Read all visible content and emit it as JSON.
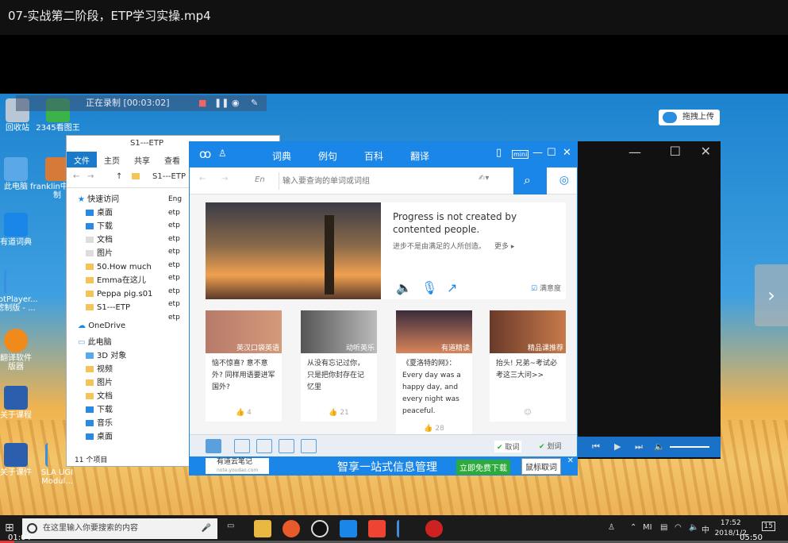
{
  "player": {
    "title": "07-实战第二阶段，ETP学习实操.mp4",
    "time_current": "01:04",
    "time_total": "05:50",
    "progress_fraction": 0.018
  },
  "recorder": {
    "status": "正在录制 [00:03:02]"
  },
  "upload": {
    "label": "拖拽上传"
  },
  "desktop_icons": [
    {
      "label": "回收站"
    },
    {
      "label": "2345看图王"
    },
    {
      "label": "此电脑"
    },
    {
      "label": "franklin中文录制"
    },
    {
      "label": "有道词典"
    },
    {
      "label": "PotPlayer...\n滤制版 - ..."
    },
    {
      "label": "翻译软件\n版器"
    },
    {
      "label": "关于课程"
    },
    {
      "label": "SLA UGI\nModul..."
    },
    {
      "label": "关于课件"
    }
  ],
  "explorer": {
    "path": "S1---ETP",
    "tabs": [
      "文件",
      "主页",
      "共享",
      "查看"
    ],
    "address": "S1---ETP",
    "nav": [
      "快速访问",
      "桌面",
      "下载",
      "文档",
      "图片",
      "50.How much",
      "Emma在这儿",
      "Peppa pig.s01",
      "S1---ETP",
      "OneDrive",
      "此电脑",
      "3D 对象",
      "视频",
      "图片",
      "文档",
      "下载",
      "音乐",
      "桌面"
    ],
    "files": [
      "Eng",
      "etp",
      "etp",
      "etp",
      "etp",
      "etp",
      "etp",
      "etp",
      "etp",
      "etp"
    ],
    "status": "11 个项目"
  },
  "dict": {
    "tabs": [
      "词典",
      "例句",
      "百科",
      "翻译"
    ],
    "mini_label": "mini",
    "lang": "En",
    "search_placeholder": "输入要查询的单词或词组",
    "quote_en": "Progress is not created by contented people.",
    "quote_cn": "进步不是由满足的人所创造。",
    "more": "更多 ▸",
    "satisfaction": "满意度",
    "cards": [
      {
        "tag": "英汉口袋英语",
        "text": "恼不惊喜? 意不意外? 同样用语要进军国外?",
        "likes": "4"
      },
      {
        "tag": "动听英乐",
        "text": "从没有忘记过你，只是把你封存在记忆里",
        "likes": "21"
      },
      {
        "tag": "有道精读",
        "text": "《夏洛特的网》：Every day was a happy day, and every night was peaceful.",
        "likes": "28"
      },
      {
        "tag": "精品课推荐",
        "text": "抬头! 兄弟~考试必考这三大问>>",
        "likes": ""
      }
    ],
    "cancel_word": "取词",
    "select_word": "划词",
    "ad_brand": "有道云笔记",
    "ad_brand_url": "note.youdao.com",
    "ad_text": "智享一站式信息管理",
    "ad_download": "立即免费下载",
    "ad_tip": "鼠标取词"
  },
  "taskbar": {
    "search_placeholder": "在这里输入你要搜索的内容",
    "time": "17:52",
    "date": "2018/1/2",
    "ime": "中",
    "badge": "15"
  }
}
